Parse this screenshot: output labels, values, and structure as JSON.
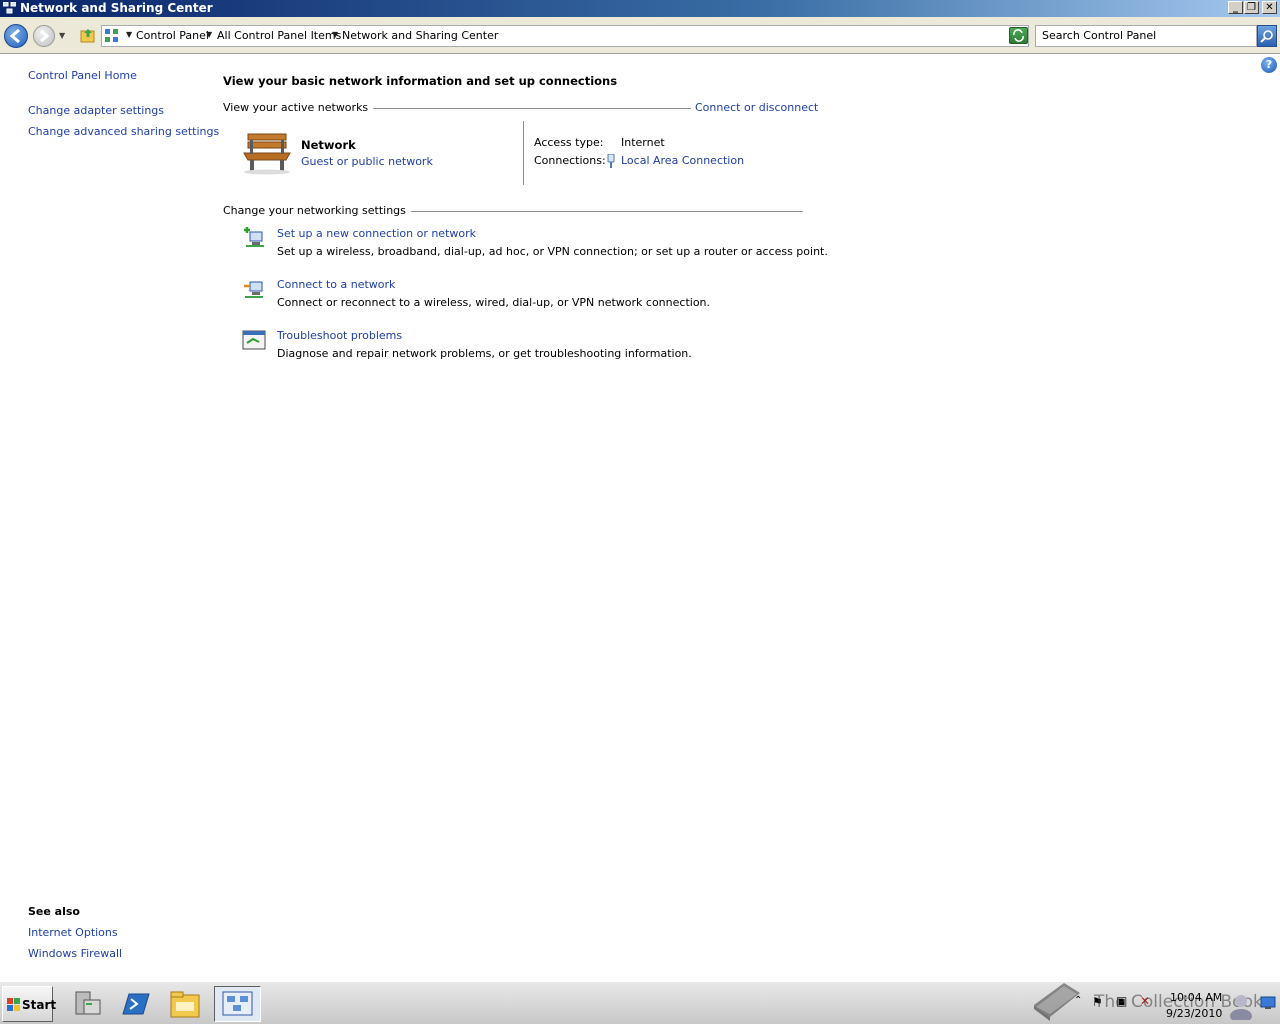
{
  "window": {
    "title": "Network and Sharing Center",
    "controls": [
      "_",
      "❐",
      "✕"
    ]
  },
  "addressbar": {
    "breadcrumbs": [
      "Control Panel",
      "All Control Panel Items",
      "Network and Sharing Center"
    ],
    "search_placeholder": "Search Control Panel"
  },
  "sidebar": {
    "home": "Control Panel Home",
    "links": [
      "Change adapter settings",
      "Change advanced sharing settings"
    ],
    "see_also_title": "See also",
    "see_also": [
      "Internet Options",
      "Windows Firewall"
    ]
  },
  "main": {
    "heading": "View your basic network information and set up connections",
    "active_networks_label": "View your active networks",
    "connect_disconnect": "Connect or disconnect",
    "network": {
      "name": "Network",
      "type": "Guest or public network",
      "access_type_label": "Access type:",
      "access_type_value": "Internet",
      "connections_label": "Connections:",
      "connections_value": "Local Area Connection"
    },
    "settings_label": "Change your networking settings",
    "tasks": [
      {
        "title": "Set up a new connection or network",
        "desc": "Set up a wireless, broadband, dial-up, ad hoc, or VPN connection; or set up a router or access point."
      },
      {
        "title": "Connect to a network",
        "desc": "Connect or reconnect to a wireless, wired, dial-up, or VPN network connection."
      },
      {
        "title": "Troubleshoot problems",
        "desc": "Diagnose and repair network problems, or get troubleshooting information."
      }
    ]
  },
  "taskbar": {
    "start_label": "Start",
    "apps": [
      "server-manager-icon",
      "powershell-icon",
      "explorer-icon",
      "network-center-icon"
    ],
    "clock_time": "10:04 AM",
    "clock_date": "9/23/2010",
    "watermark": "The Collection Book"
  },
  "colors": {
    "link": "#1e3fa8",
    "titlebar_start": "#0a246a",
    "titlebar_end": "#a6caf0"
  }
}
